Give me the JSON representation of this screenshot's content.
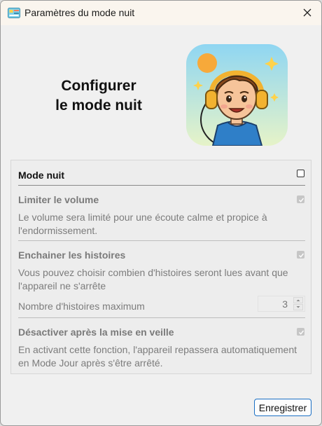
{
  "window": {
    "title": "Paramètres du mode nuit",
    "app_icon": "app-badge-icon",
    "close_icon": "close-icon"
  },
  "hero": {
    "title_line1": "Configurer",
    "title_line2": "le mode nuit",
    "image": "child-with-headphones-illustration"
  },
  "settings": {
    "night_mode": {
      "label": "Mode nuit",
      "checked": false
    },
    "limit_volume": {
      "label": "Limiter le volume",
      "checked": true,
      "description": "Le volume sera limité pour une écoute calme et propice à l'endormissement."
    },
    "chain_stories": {
      "label": "Enchainer les histoires",
      "checked": true,
      "description": "Vous pouvez choisir combien d'histoires seront lues avant que l'appareil ne s'arrête",
      "max_label": "Nombre d'histoires maximum",
      "max_value": "3"
    },
    "disable_after_sleep": {
      "label": "Désactiver après la mise en veille",
      "checked": true,
      "description": "En activant cette fonction, l'appareil repassera automatiquement en Mode Jour après s'être arrêté."
    }
  },
  "footer": {
    "save_label": "Enregistrer"
  },
  "colors": {
    "accent": "#1a6fc4",
    "disabled_text": "#7a7a7a"
  }
}
